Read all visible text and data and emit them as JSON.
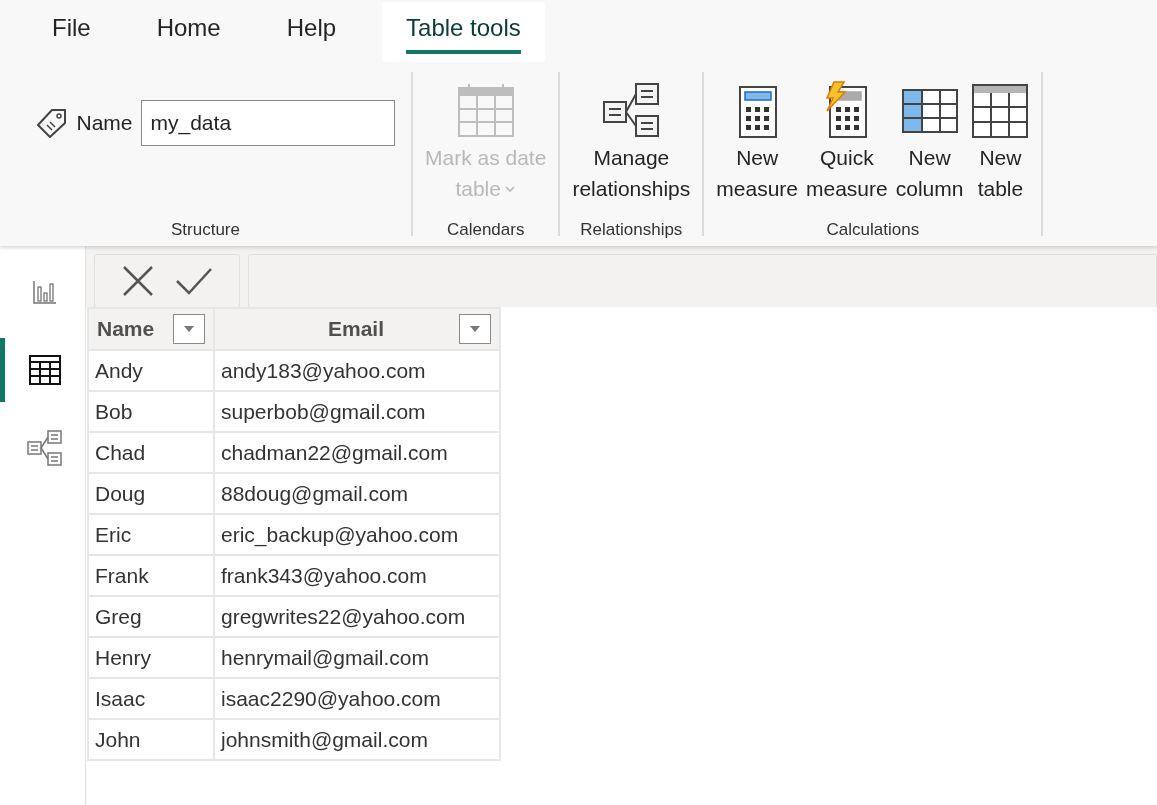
{
  "menu_tabs": [
    {
      "label": "File",
      "selected": false
    },
    {
      "label": "Home",
      "selected": false
    },
    {
      "label": "Help",
      "selected": false
    },
    {
      "label": "Table tools",
      "selected": true
    }
  ],
  "ribbon": {
    "groups": [
      {
        "label": "Structure",
        "name_field": {
          "label": "Name",
          "value": "my_data"
        }
      },
      {
        "label": "Calendars",
        "buttons": [
          {
            "kind": "calendar",
            "lines": [
              "Mark as date",
              "table"
            ],
            "disabled": true,
            "dropdown": true
          }
        ]
      },
      {
        "label": "Relationships",
        "buttons": [
          {
            "kind": "relationships",
            "lines": [
              "Manage",
              "relationships"
            ],
            "disabled": false,
            "dropdown": false
          }
        ]
      },
      {
        "label": "Calculations",
        "buttons": [
          {
            "kind": "measure",
            "lines": [
              "New",
              "measure"
            ],
            "disabled": false,
            "dropdown": false
          },
          {
            "kind": "quick_measure",
            "lines": [
              "Quick",
              "measure"
            ],
            "disabled": false,
            "dropdown": false
          },
          {
            "kind": "column",
            "lines": [
              "New",
              "column"
            ],
            "disabled": false,
            "dropdown": false
          },
          {
            "kind": "table",
            "lines": [
              "New",
              "table"
            ],
            "disabled": false,
            "dropdown": false
          }
        ]
      }
    ]
  },
  "sidebar": {
    "items": [
      {
        "kind": "report",
        "selected": false
      },
      {
        "kind": "data",
        "selected": true
      },
      {
        "kind": "model",
        "selected": false
      }
    ]
  },
  "table": {
    "columns": [
      "Name",
      "Email"
    ],
    "rows": [
      [
        "Andy",
        "andy183@yahoo.com"
      ],
      [
        "Bob",
        "superbob@gmail.com"
      ],
      [
        "Chad",
        "chadman22@gmail.com"
      ],
      [
        "Doug",
        "88doug@gmail.com"
      ],
      [
        "Eric",
        "eric_backup@yahoo.com"
      ],
      [
        "Frank",
        "frank343@yahoo.com"
      ],
      [
        "Greg",
        "gregwrites22@yahoo.com"
      ],
      [
        "Henry",
        "henrymail@gmail.com"
      ],
      [
        "Isaac",
        "isaac2290@yahoo.com"
      ],
      [
        "John",
        "johnsmith@gmail.com"
      ]
    ]
  }
}
